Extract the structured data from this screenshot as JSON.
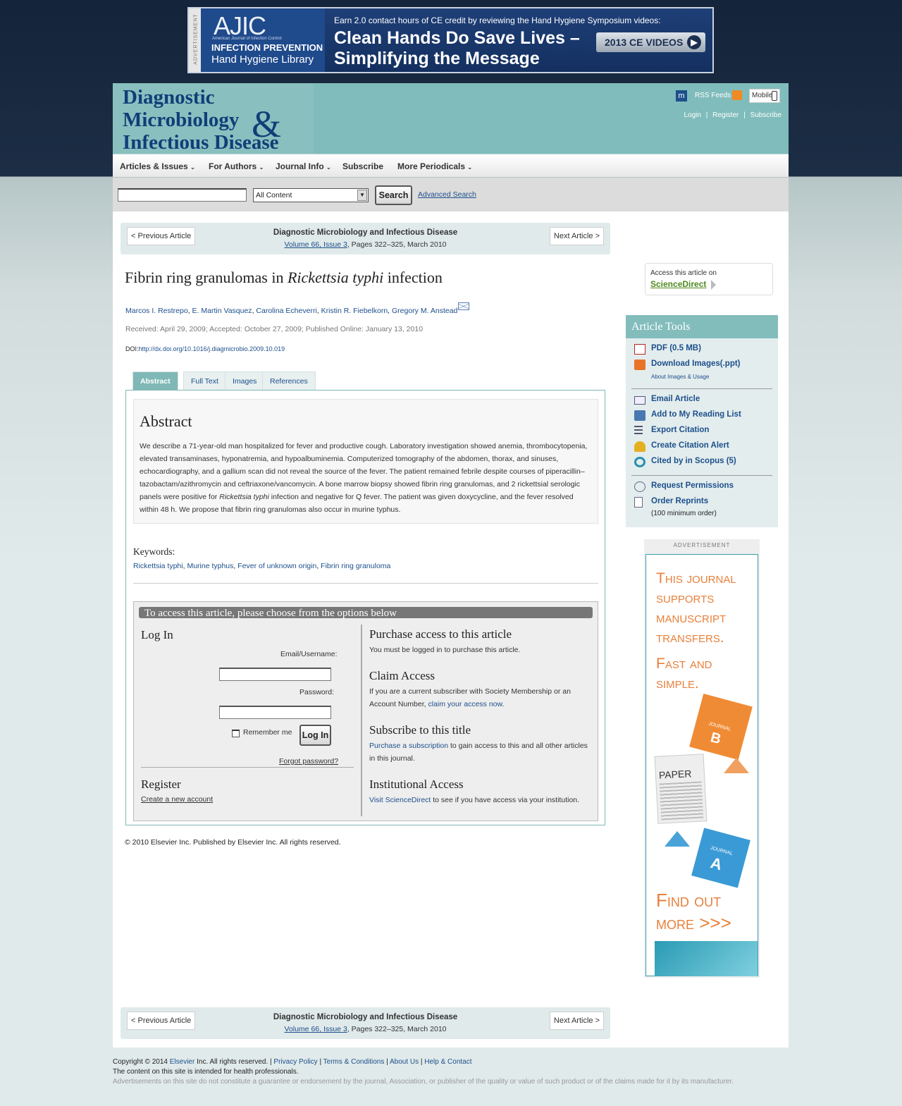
{
  "top_ad": {
    "side_label": "ADVERTISEMENT",
    "ajic": "AJIC",
    "ajic_sub": "American Journal of Infection Control",
    "line1": "INFECTION PREVENTION",
    "line2": "Hand Hygiene Library",
    "headline_small": "Earn 2.0 contact hours of CE credit by reviewing the Hand Hygiene Symposium videos:",
    "headline_1": "Clean Hands Do Save Lives –",
    "headline_2": "Simplifying the Message",
    "button": "2013 CE VIDEOS"
  },
  "masthead": {
    "line1": "Diagnostic",
    "line2": "Microbiology",
    "amp": "&",
    "line3": "Infectious Disease"
  },
  "header_links": {
    "rss": "RSS Feeds",
    "mobile": "Mobile",
    "login": "Login",
    "register": "Register",
    "subscribe": "Subscribe"
  },
  "nav": [
    "Articles & Issues",
    "For Authors",
    "Journal Info",
    "Subscribe",
    "More Periodicals"
  ],
  "search": {
    "select_value": "All Content",
    "button": "Search",
    "advanced": "Advanced Search"
  },
  "article_nav": {
    "prev": "< Previous Article",
    "next": "Next Article >",
    "journal": "Diagnostic Microbiology and Infectious Disease",
    "volume_link": "Volume 66, Issue 3",
    "pages": ", Pages 322–325, March 2010"
  },
  "article": {
    "title_pre": "Fibrin ring granulomas in ",
    "title_italic": "Rickettsia typhi",
    "title_post": " infection",
    "authors": [
      "Marcos I. Restrepo",
      "E. Martin Vasquez",
      "Carolina Echeverri",
      "Kristin R. Fiebelkorn",
      "Gregory M. Anstead"
    ],
    "dates": "Received: April 29, 2009; Accepted: October 27, 2009; Published Online: January 13, 2010",
    "doi_label": "DOI:",
    "doi": "http://dx.doi.org/10.1016/j.diagmicrobio.2009.10.019"
  },
  "tabs": [
    "Abstract",
    "Full Text",
    "Images",
    "References"
  ],
  "abstract": {
    "heading": "Abstract",
    "text_1": "We describe a 71-year-old man hospitalized for fever and productive cough. Laboratory investigation showed anemia, thrombocytopenia, elevated transaminases, hyponatremia, and hypoalbuminemia. Computerized tomography of the abdomen, thorax, and sinuses, echocardiography, and a gallium scan did not reveal the source of the fever. The patient remained febrile despite courses of piperacillin–tazobactam/azithromycin and ceftriaxone/vancomycin. A bone marrow biopsy showed fibrin ring granulomas, and 2 rickettsial serologic panels were positive for ",
    "text_italic": "Rickettsia typhi",
    "text_2": " infection and negative for Q fever. The patient was given doxycycline, and the fever resolved within 48 h. We propose that fibrin ring granulomas also occur in murine typhus."
  },
  "keywords": {
    "label": "Keywords:",
    "items": [
      "Rickettsia typhi",
      "Murine typhus",
      "Fever of unknown origin",
      "Fibrin ring granuloma"
    ]
  },
  "access": {
    "bar": "To access this article, please choose from the options below",
    "login_heading": "Log In",
    "email_label": "Email/Username:",
    "password_label": "Password:",
    "remember": "Remember me",
    "login_button": "Log In",
    "forgot": "Forgot password?",
    "register_heading": "Register",
    "register_link": "Create a new account",
    "purchase_heading": "Purchase access to this article",
    "purchase_text": "You must be logged in to purchase this article.",
    "claim_heading": "Claim Access",
    "claim_text": "If you are a current subscriber with Society Membership or an Account Number, ",
    "claim_link": "claim your access now",
    "subscribe_heading": "Subscribe to this title",
    "subscribe_link": "Purchase a subscription",
    "subscribe_text": " to gain access to this and all other articles in this journal.",
    "inst_heading": "Institutional Access",
    "inst_link": "Visit ScienceDirect",
    "inst_text": " to see if you have access via your institution."
  },
  "copyright_article": "© 2010 Elsevier Inc. Published by Elsevier Inc. All rights reserved.",
  "sciencedirect": {
    "label": "Access this article on",
    "link": "ScienceDirect"
  },
  "tools": {
    "heading": "Article Tools",
    "pdf": "PDF (0.5 MB)",
    "download_images": "Download Images(.ppt)",
    "about_images": "About Images & Usage",
    "email": "Email Article",
    "reading_list": "Add to My Reading List",
    "export": "Export Citation",
    "alert": "Create Citation Alert",
    "scopus": "Cited by in Scopus (5)",
    "permissions": "Request Permissions",
    "reprints": "Order Reprints",
    "reprints_note": "(100 minimum order)"
  },
  "right_ad": {
    "label": "ADVERTISEMENT",
    "line1": "This journal",
    "line2": "supports",
    "line3": "manuscript",
    "line4": "transfers.",
    "line5": "Fast and",
    "line6": "simple.",
    "find1": "Find out",
    "find2": "more >>>",
    "paper": "PAPER",
    "journal": "JOURNAL",
    "b": "B",
    "a": "A"
  },
  "footer": {
    "copyright_pre": "Copyright © 2014 ",
    "elsevier": "Elsevier",
    "copyright_post": " Inc. All rights reserved. | ",
    "privacy": "Privacy Policy",
    "terms": "Terms & Conditions",
    "about": "About Us",
    "help": "Help & Contact",
    "sep": " | ",
    "note1": "The content on this site is intended for health professionals.",
    "note2": "Advertisements on this site do not constitute a guarantee or endorsement by the journal, Association, or publisher of the quality or value of such product or of the claims made for it by its manufacturer."
  },
  "colors": {
    "header_teal": "#80bcbb",
    "link_blue": "#1d4f8c",
    "masthead_blue": "#103e78",
    "ad_orange": "#e8803a"
  }
}
